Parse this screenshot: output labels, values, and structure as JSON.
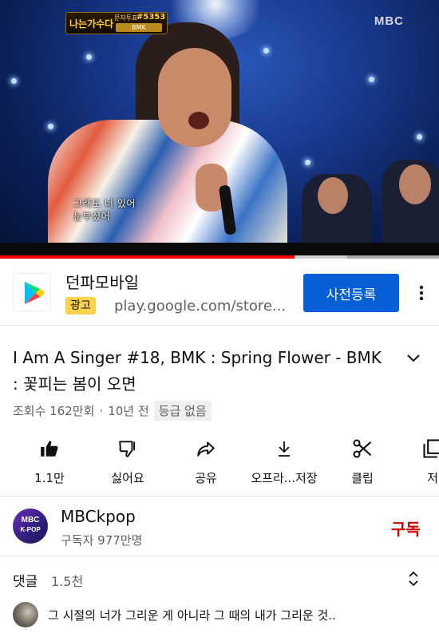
{
  "video": {
    "show_logo_text": "나는가수다",
    "vote_label": "문자투표",
    "vote_number": "#5353",
    "contestant_name": "BMK",
    "subtitle_line1": "그래도 너 있어",
    "subtitle_line2": "눈부셨어",
    "broadcaster_logo": "MBC",
    "progress_fraction": 0.67,
    "buffer_fraction": 0.79
  },
  "ad": {
    "app_name": "던파모바일",
    "badge": "광고",
    "url": "play.google.com/store...",
    "cta_label": "사전등록",
    "logo_icon": "google-play-icon",
    "more_icon": "more-vert-icon"
  },
  "video_info": {
    "title": "I Am A Singer #18, BMK : Spring Flower - BMK : 꽃피는 봄이 오면",
    "views": "조회수 162만회",
    "separator": "·",
    "age": "10년 전",
    "rating": "등급 없음",
    "expand_icon": "chevron-down-icon"
  },
  "actions": [
    {
      "name": "like",
      "label": "1.1만",
      "icon": "thumbs-up-icon"
    },
    {
      "name": "dislike",
      "label": "싫어요",
      "icon": "thumbs-down-icon"
    },
    {
      "name": "share",
      "label": "공유",
      "icon": "share-icon"
    },
    {
      "name": "download",
      "label": "오프라...저장",
      "icon": "download-icon"
    },
    {
      "name": "clip",
      "label": "클립",
      "icon": "scissors-icon"
    },
    {
      "name": "save",
      "label": "저",
      "icon": "playlist-add-icon"
    }
  ],
  "channel": {
    "avatar_line1": "MBC",
    "avatar_line2": "K-POP",
    "name": "MBCkpop",
    "subscribers": "구독자 977만명",
    "subscribe_label": "구독"
  },
  "comments": {
    "header": "댓글",
    "count": "1.5천",
    "first_comment": "그 시절의 너가 그리운 게 아니라 그 때의 내가 그리운 것..",
    "sort_icon": "unfold-icon"
  },
  "colors": {
    "accent_red": "#ff0000",
    "cta_blue": "#065fd4",
    "subscribe_red": "#cc0000",
    "ad_badge_yellow": "#fbd34b"
  }
}
